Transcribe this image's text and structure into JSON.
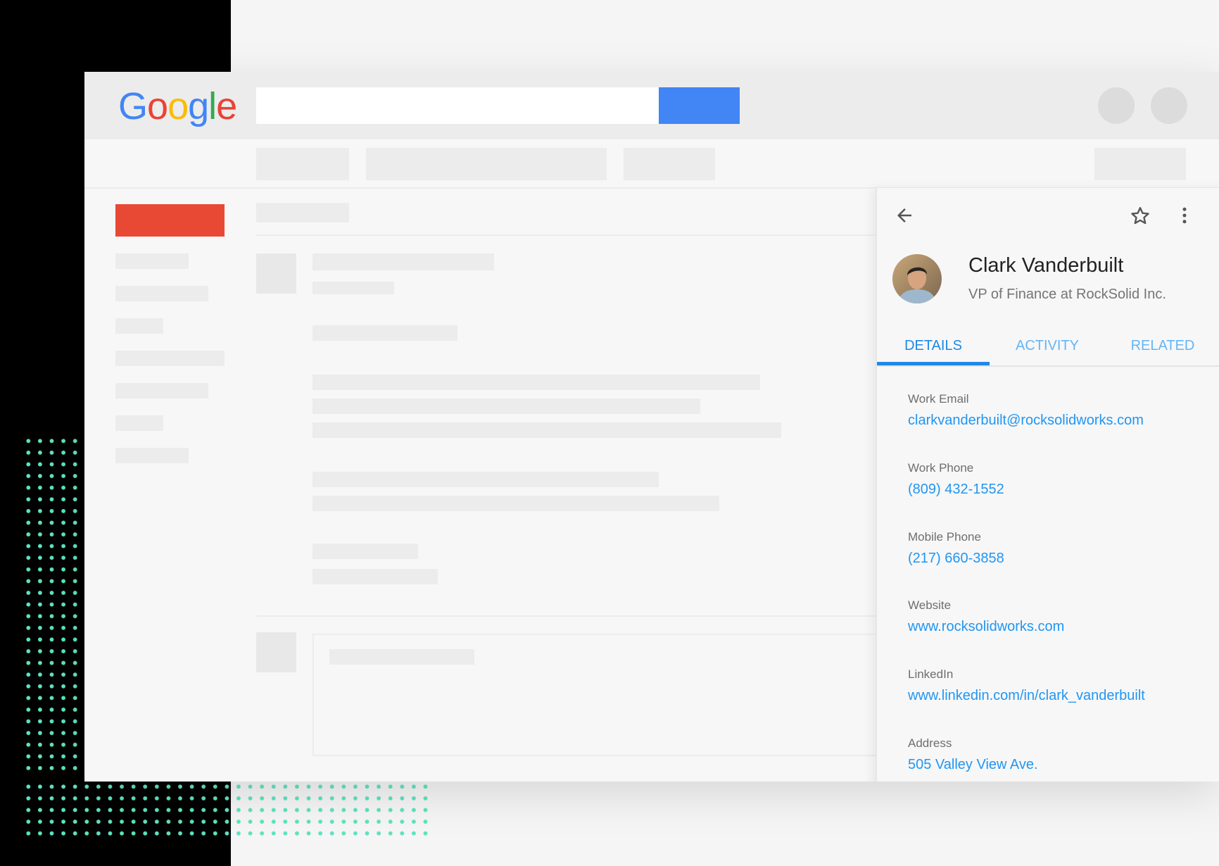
{
  "header": {
    "logo_letters": [
      "G",
      "o",
      "o",
      "g",
      "l",
      "e"
    ],
    "search_placeholder": ""
  },
  "contact": {
    "name": "Clark Vanderbuilt",
    "title": "VP of Finance at RockSolid Inc."
  },
  "tabs": [
    {
      "label": "DETAILS",
      "active": true
    },
    {
      "label": "ACTIVITY",
      "active": false
    },
    {
      "label": "RELATED",
      "active": false
    }
  ],
  "fields": [
    {
      "label": "Work Email",
      "value": "clarkvanderbuilt@rocksolidworks.com"
    },
    {
      "label": "Work Phone",
      "value": "(809) 432-1552"
    },
    {
      "label": "Mobile Phone",
      "value": "(217) 660-3858"
    },
    {
      "label": "Website",
      "value": "www.rocksolidworks.com"
    },
    {
      "label": "LinkedIn",
      "value": "www.linkedin.com/in/clark_vanderbuilt"
    },
    {
      "label": "Address",
      "value": "505 Valley View Ave."
    }
  ],
  "icons": {
    "back": "arrow-back-icon",
    "star": "star-outline-icon",
    "more": "more-vert-icon"
  },
  "colors": {
    "accent": "#1e88e5",
    "link": "#2196f3",
    "compose": "#e84935",
    "search_button": "#4285f4",
    "dots": "#5ee3bf"
  }
}
